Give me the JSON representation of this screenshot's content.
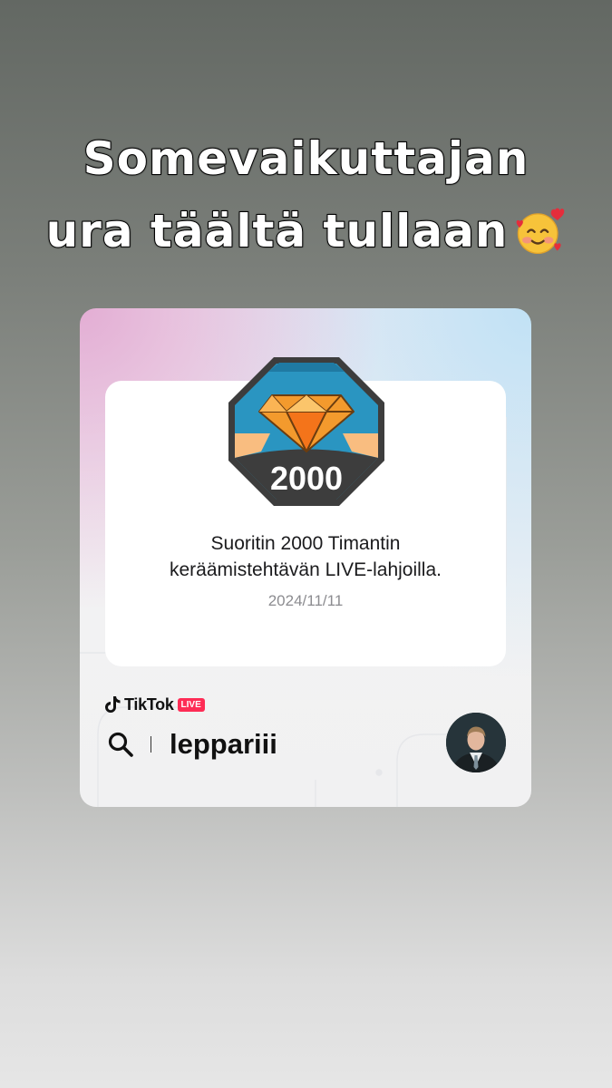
{
  "headline": {
    "line1": "Somevaikuttajan",
    "line2": "ura täältä tullaan",
    "emoji_icon": "smiling-face-with-hearts-icon"
  },
  "card": {
    "badge": {
      "number": "2000",
      "icon": "diamond-icon"
    },
    "achievement_line1": "Suoritin 2000 Timantin",
    "achievement_line2": "keräämistehtävän LIVE-lahjoilla.",
    "date": "2024/11/11",
    "brand": {
      "name": "TikTok",
      "live_label": "LIVE"
    },
    "search": {
      "icon": "search-icon",
      "username": "leppariii"
    },
    "avatar_icon": "profile-avatar"
  },
  "colors": {
    "accent_live": "#fe2c55",
    "badge_teal": "#2a95c1",
    "badge_orange": "#f08a1c",
    "badge_dark": "#3d3d3d"
  }
}
